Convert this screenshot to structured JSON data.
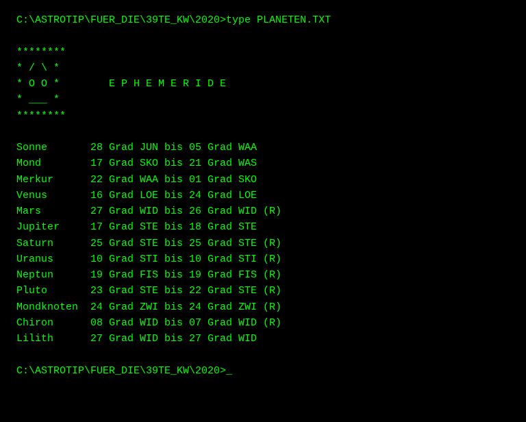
{
  "terminal": {
    "prompt_top": "C:\\ASTROTIP\\FUER_DIE\\39TE_KW\\2020>type PLANETEN.TXT",
    "prompt_bottom": "C:\\ASTROTIP\\FUER_DIE\\39TE_KW\\2020>_",
    "logo": [
      "********",
      "* / \\ *",
      "* O O *",
      "* ___ *",
      "********"
    ],
    "ephemeriden_title": "E P H E M E R I D E",
    "planets": [
      {
        "name": "Sonne",
        "from_deg": "28",
        "from_sign": "JUN",
        "to_deg": "05",
        "to_sign": "WAA",
        "retro": ""
      },
      {
        "name": "Mond",
        "from_deg": "17",
        "from_sign": "SKO",
        "to_deg": "21",
        "to_sign": "WAS",
        "retro": ""
      },
      {
        "name": "Merkur",
        "from_deg": "22",
        "from_sign": "WAA",
        "to_deg": "01",
        "to_sign": "SKO",
        "retro": ""
      },
      {
        "name": "Venus",
        "from_deg": "16",
        "from_sign": "LOE",
        "to_deg": "24",
        "to_sign": "LOE",
        "retro": ""
      },
      {
        "name": "Mars",
        "from_deg": "27",
        "from_sign": "WID",
        "to_deg": "26",
        "to_sign": "WID",
        "retro": "(R)"
      },
      {
        "name": "Jupiter",
        "from_deg": "17",
        "from_sign": "STE",
        "to_deg": "18",
        "to_sign": "STE",
        "retro": ""
      },
      {
        "name": "Saturn",
        "from_deg": "25",
        "from_sign": "STE",
        "to_deg": "25",
        "to_sign": "STE",
        "retro": "(R)"
      },
      {
        "name": "Uranus",
        "from_deg": "10",
        "from_sign": "STI",
        "to_deg": "10",
        "to_sign": "STI",
        "retro": "(R)"
      },
      {
        "name": "Neptun",
        "from_deg": "19",
        "from_sign": "FIS",
        "to_deg": "19",
        "to_sign": "FIS",
        "retro": "(R)"
      },
      {
        "name": "Pluto",
        "from_deg": "23",
        "from_sign": "STE",
        "to_deg": "22",
        "to_sign": "STE",
        "retro": "(R)"
      },
      {
        "name": "Mondknoten",
        "from_deg": "24",
        "from_sign": "ZWI",
        "to_deg": "24",
        "to_sign": "ZWI",
        "retro": "(R)"
      },
      {
        "name": "Chiron",
        "from_deg": "08",
        "from_sign": "WID",
        "to_deg": "07",
        "to_sign": "WID",
        "retro": "(R)"
      },
      {
        "name": "Lilith",
        "from_deg": "27",
        "from_sign": "WID",
        "to_deg": "27",
        "to_sign": "WID",
        "retro": ""
      }
    ]
  }
}
